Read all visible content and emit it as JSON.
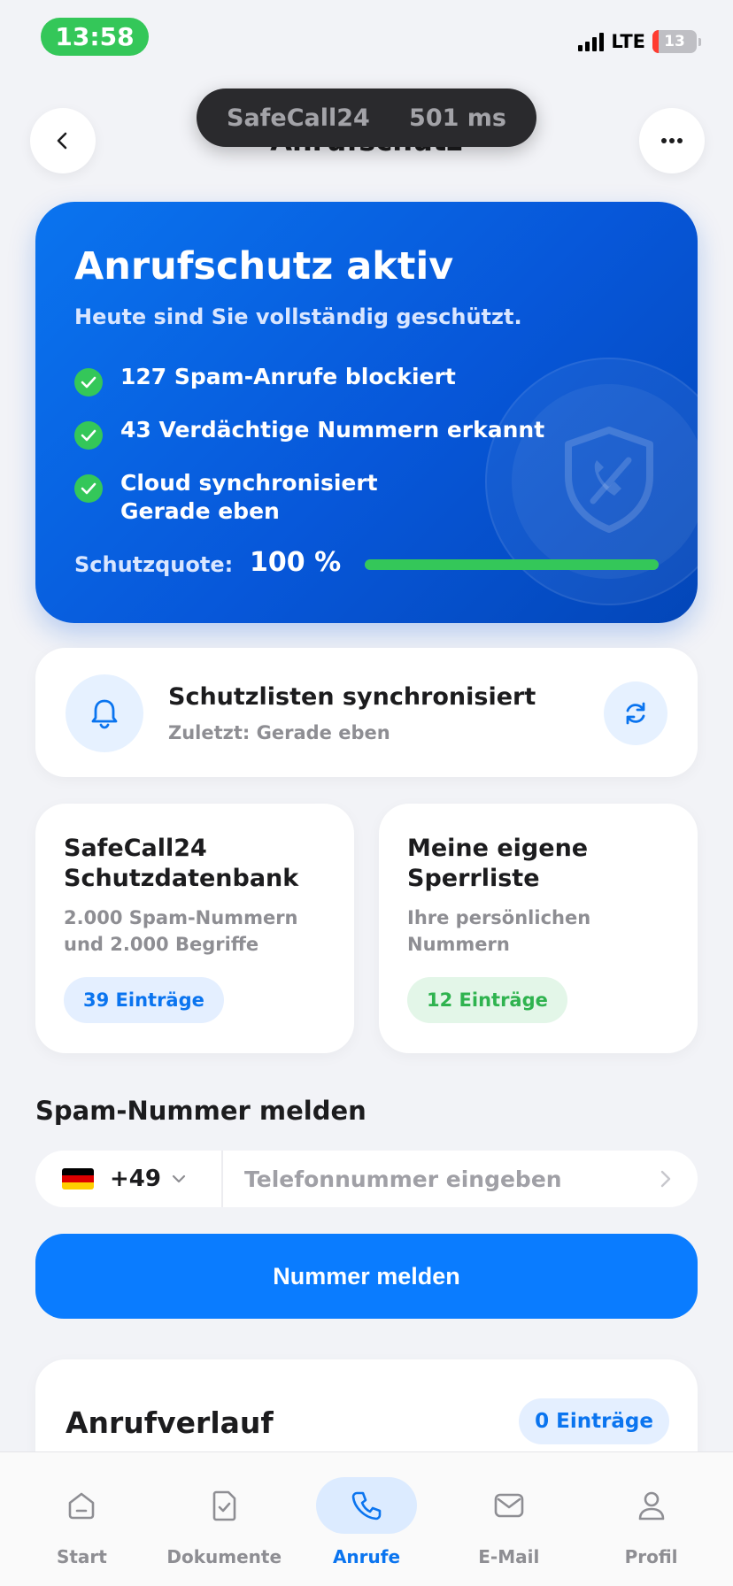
{
  "status_bar": {
    "time": "13:58",
    "network": "LTE",
    "battery": "13",
    "battery_level_percent": 13
  },
  "header": {
    "title": "Anrufschutz",
    "back_icon": "chevron-left-icon",
    "more_icon": "ellipsis-icon"
  },
  "toast": {
    "app": "SafeCall24",
    "latency": "501 ms"
  },
  "hero": {
    "title": "Anrufschutz aktiv",
    "subtitle": "Heute sind Sie vollständig geschützt.",
    "checks": [
      {
        "text": "127 Spam-Anrufe blockiert"
      },
      {
        "text": "43 Verdächtige Nummern erkannt"
      },
      {
        "text": "Cloud synchronisiert",
        "detail": "Gerade eben"
      }
    ],
    "quota_label": "Schutzquote:",
    "quota_value": "100 %",
    "quota_percent": 100,
    "colors": {
      "gradient_start": "#0a74ef",
      "gradient_end": "#0346b8",
      "success": "#34c759"
    }
  },
  "sync": {
    "title": "Schutzlisten synchronisiert",
    "subtitle": "Zuletzt: Gerade eben",
    "icon": "bell-icon",
    "refresh_icon": "refresh-icon"
  },
  "lists": [
    {
      "title_line1": "SafeCall24",
      "title_line2": "Schutzdatenbank",
      "desc_line1": "2.000 Spam-Nummern",
      "desc_line2": "und 2.000 Begriffe",
      "badge": "39 Einträge",
      "badge_color": "#0a74ef"
    },
    {
      "title_line1": "Meine eigene",
      "title_line2": "Sperrliste",
      "desc_line1": "Ihre persönlichen",
      "desc_line2": "Nummern",
      "badge": "12 Einträge",
      "badge_color": "#2fb34f"
    }
  ],
  "report": {
    "section_title": "Spam-Nummer melden",
    "country_code": "+49",
    "flag": "germany-flag",
    "phone_placeholder": "Telefonnummer eingeben",
    "phone_value": "",
    "button_label": "Nummer melden",
    "accent": "#0a7cff"
  },
  "history": {
    "title": "Anrufverlauf",
    "badge": "0 Einträge"
  },
  "tabs": [
    {
      "label": "Start",
      "icon": "home-icon",
      "active": false
    },
    {
      "label": "Dokumente",
      "icon": "document-check-icon",
      "active": false
    },
    {
      "label": "Anrufe",
      "icon": "phone-icon",
      "active": true
    },
    {
      "label": "E-Mail",
      "icon": "mail-icon",
      "active": false
    },
    {
      "label": "Profil",
      "icon": "person-icon",
      "active": false
    }
  ]
}
